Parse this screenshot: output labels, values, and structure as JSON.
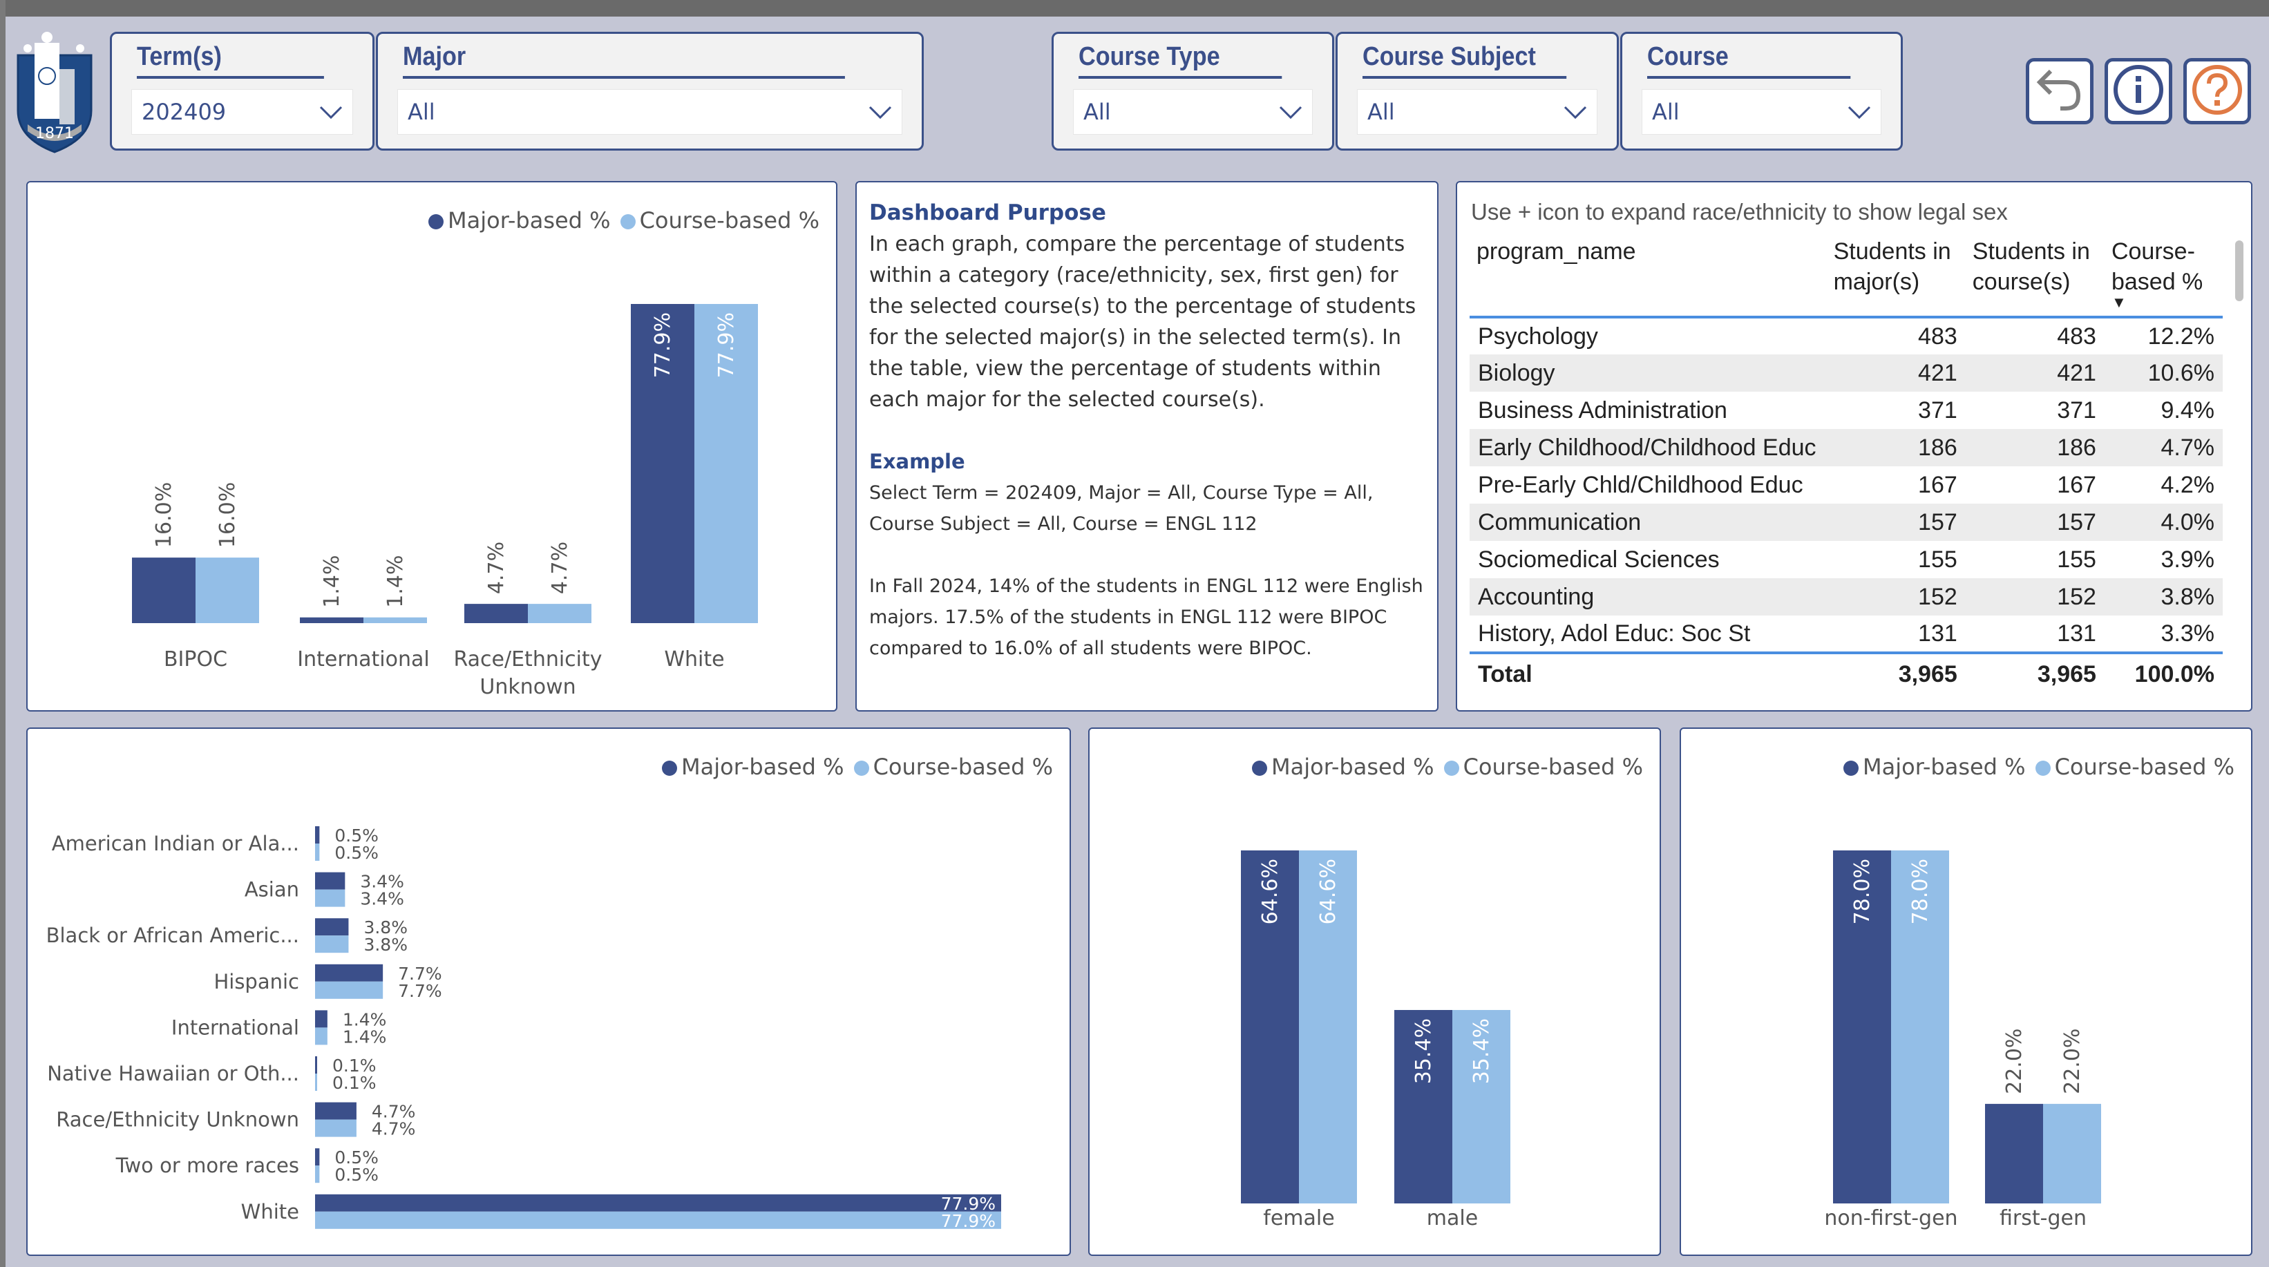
{
  "colors": {
    "major": "#3b4f8a",
    "course": "#93bee7",
    "accent": "#3b5189",
    "help": "#e07a45"
  },
  "header": {
    "logo": {
      "year": "1871"
    },
    "slicers": [
      {
        "title": "Term(s)",
        "value": "202409"
      },
      {
        "title": "Major",
        "value": "All"
      },
      {
        "title": "Course Type",
        "value": "All"
      },
      {
        "title": "Course Subject",
        "value": "All"
      },
      {
        "title": "Course",
        "value": "All"
      }
    ],
    "buttons": [
      {
        "icon": "back-arrow-icon"
      },
      {
        "icon": "info-icon"
      },
      {
        "icon": "help-icon"
      }
    ]
  },
  "legend": {
    "major": "Major-based %",
    "course": "Course-based %"
  },
  "purpose": {
    "title": "Dashboard Purpose",
    "body": "In each graph, compare the percentage of students within a category (race/ethnicity, sex, first gen) for the selected course(s) to the percentage of students for the selected major(s) in the selected term(s). In the table, view the percentage of students within each major for the selected course(s).",
    "example_title": "Example",
    "example_1": "Select Term = 202409, Major = All, Course Type = All, Course Subject = All, Course = ENGL 112",
    "example_2": "In Fall 2024, 14% of the students in ENGL 112 were English majors. 17.5% of the students in ENGL 112 were BIPOC compared to 16.0% of all students were BIPOC."
  },
  "table": {
    "note": "Use + icon to expand race/ethnicity to show legal sex",
    "columns": [
      "program_name",
      "Students in major(s)",
      "Students in course(s)",
      "Course-based %"
    ],
    "sort_indicator": "▼",
    "rows": [
      [
        "Psychology",
        "483",
        "483",
        "12.2%"
      ],
      [
        "Biology",
        "421",
        "421",
        "10.6%"
      ],
      [
        "Business Administration",
        "371",
        "371",
        "9.4%"
      ],
      [
        "Early Childhood/Childhood Educ",
        "186",
        "186",
        "4.7%"
      ],
      [
        "Pre-Early Chld/Childhood Educ",
        "167",
        "167",
        "4.2%"
      ],
      [
        "Communication",
        "157",
        "157",
        "4.0%"
      ],
      [
        "Sociomedical Sciences",
        "155",
        "155",
        "3.9%"
      ],
      [
        "Accounting",
        "152",
        "152",
        "3.8%"
      ],
      [
        "History, Adol Educ: Soc St",
        "131",
        "131",
        "3.3%"
      ]
    ],
    "total": [
      "Total",
      "3,965",
      "3,965",
      "100.0%"
    ]
  },
  "chart_data": [
    {
      "type": "bar",
      "orientation": "vertical",
      "categories": [
        "BIPOC",
        "International",
        "Race/Ethnicity Unknown",
        "White"
      ],
      "series": [
        {
          "name": "Major-based %",
          "values": [
            16.0,
            1.4,
            4.7,
            77.9
          ]
        },
        {
          "name": "Course-based %",
          "values": [
            16.0,
            1.4,
            4.7,
            77.9
          ]
        }
      ],
      "legend": "top-right",
      "grid": false
    },
    {
      "type": "bar",
      "orientation": "horizontal",
      "categories": [
        "American Indian or Ala...",
        "Asian",
        "Black or African Americ...",
        "Hispanic",
        "International",
        "Native Hawaiian or Oth...",
        "Race/Ethnicity Unknown",
        "Two or more races",
        "White"
      ],
      "series": [
        {
          "name": "Major-based %",
          "values": [
            0.5,
            3.4,
            3.8,
            7.7,
            1.4,
            0.1,
            4.7,
            0.5,
            77.9
          ]
        },
        {
          "name": "Course-based %",
          "values": [
            0.5,
            3.4,
            3.8,
            7.7,
            1.4,
            0.1,
            4.7,
            0.5,
            77.9
          ]
        }
      ],
      "legend": "top-right",
      "grid": false
    },
    {
      "type": "bar",
      "orientation": "vertical",
      "categories": [
        "female",
        "male"
      ],
      "series": [
        {
          "name": "Major-based %",
          "values": [
            64.6,
            35.4
          ]
        },
        {
          "name": "Course-based %",
          "values": [
            64.6,
            35.4
          ]
        }
      ],
      "legend": "top-right",
      "grid": false
    },
    {
      "type": "bar",
      "orientation": "vertical",
      "categories": [
        "non-first-gen",
        "first-gen"
      ],
      "series": [
        {
          "name": "Major-based %",
          "values": [
            78.0,
            22.0
          ]
        },
        {
          "name": "Course-based %",
          "values": [
            78.0,
            22.0
          ]
        }
      ],
      "legend": "top-right",
      "grid": false
    }
  ]
}
